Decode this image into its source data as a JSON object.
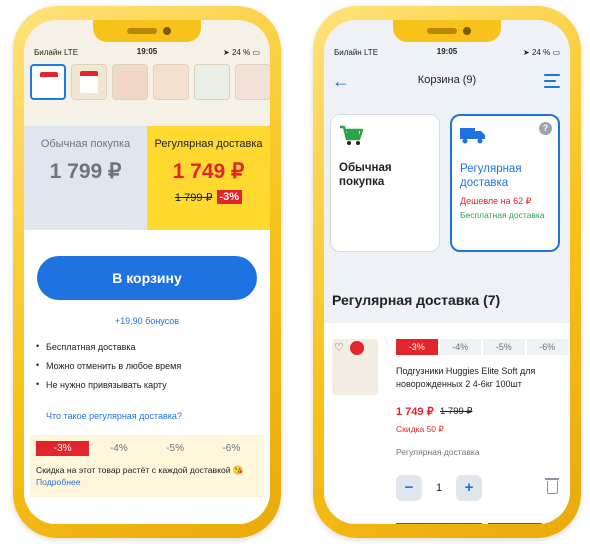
{
  "colors": {
    "accent": "#1f73e0",
    "sale": "#e3242b",
    "subscription": "#ffd92f",
    "free": "#2aa34a",
    "frame": "#f7c21a"
  },
  "status_bar": {
    "carrier": "Билайн LTE",
    "time": "19:05",
    "battery": "24 %"
  },
  "product_screen": {
    "thumbnails": [
      "thumb-1",
      "thumb-2",
      "thumb-3",
      "thumb-4",
      "thumb-5",
      "thumb-6"
    ],
    "regular": {
      "title": "Обычная покупка",
      "price": "1 799 ₽"
    },
    "subscription": {
      "title": "Регулярная доставка",
      "price": "1 749 ₽",
      "old_price": "1 799 ₽",
      "discount": "-3%"
    },
    "cart_button": "В корзину",
    "bonus": "+19,90 бонусов",
    "benefits": [
      "Бесплатная доставка",
      "Можно отменить в любое время",
      "Не нужно привязывать карту"
    ],
    "what_link": "Что такое регулярная доставка?",
    "discount_steps": [
      "-3%",
      "-4%",
      "-5%",
      "-6%"
    ],
    "discount_text": "Скидка на этот товар растёт с каждой доставкой 😘",
    "more_link": "Подробнее"
  },
  "cart_screen": {
    "title": "Корзина (9)",
    "option_regular": {
      "title": "Обычная покупка"
    },
    "option_subscription": {
      "title": "Регулярная доставка",
      "cheaper": "Дешевле на 62 ₽",
      "free": "Бесплатная доставка"
    },
    "section_title": "Регулярная доставка (7)",
    "item": {
      "discount_steps": [
        "-3%",
        "-4%",
        "-5%",
        "-6%"
      ],
      "name": "Подгузники Huggies Elite Soft для новорожденных 2 4-6кг 100шт",
      "price": "1 749 ₽",
      "old_price": "1 799 ₽",
      "saving": "Скидка 50 ₽",
      "type": "Регулярная доставка",
      "quantity": "1"
    }
  }
}
